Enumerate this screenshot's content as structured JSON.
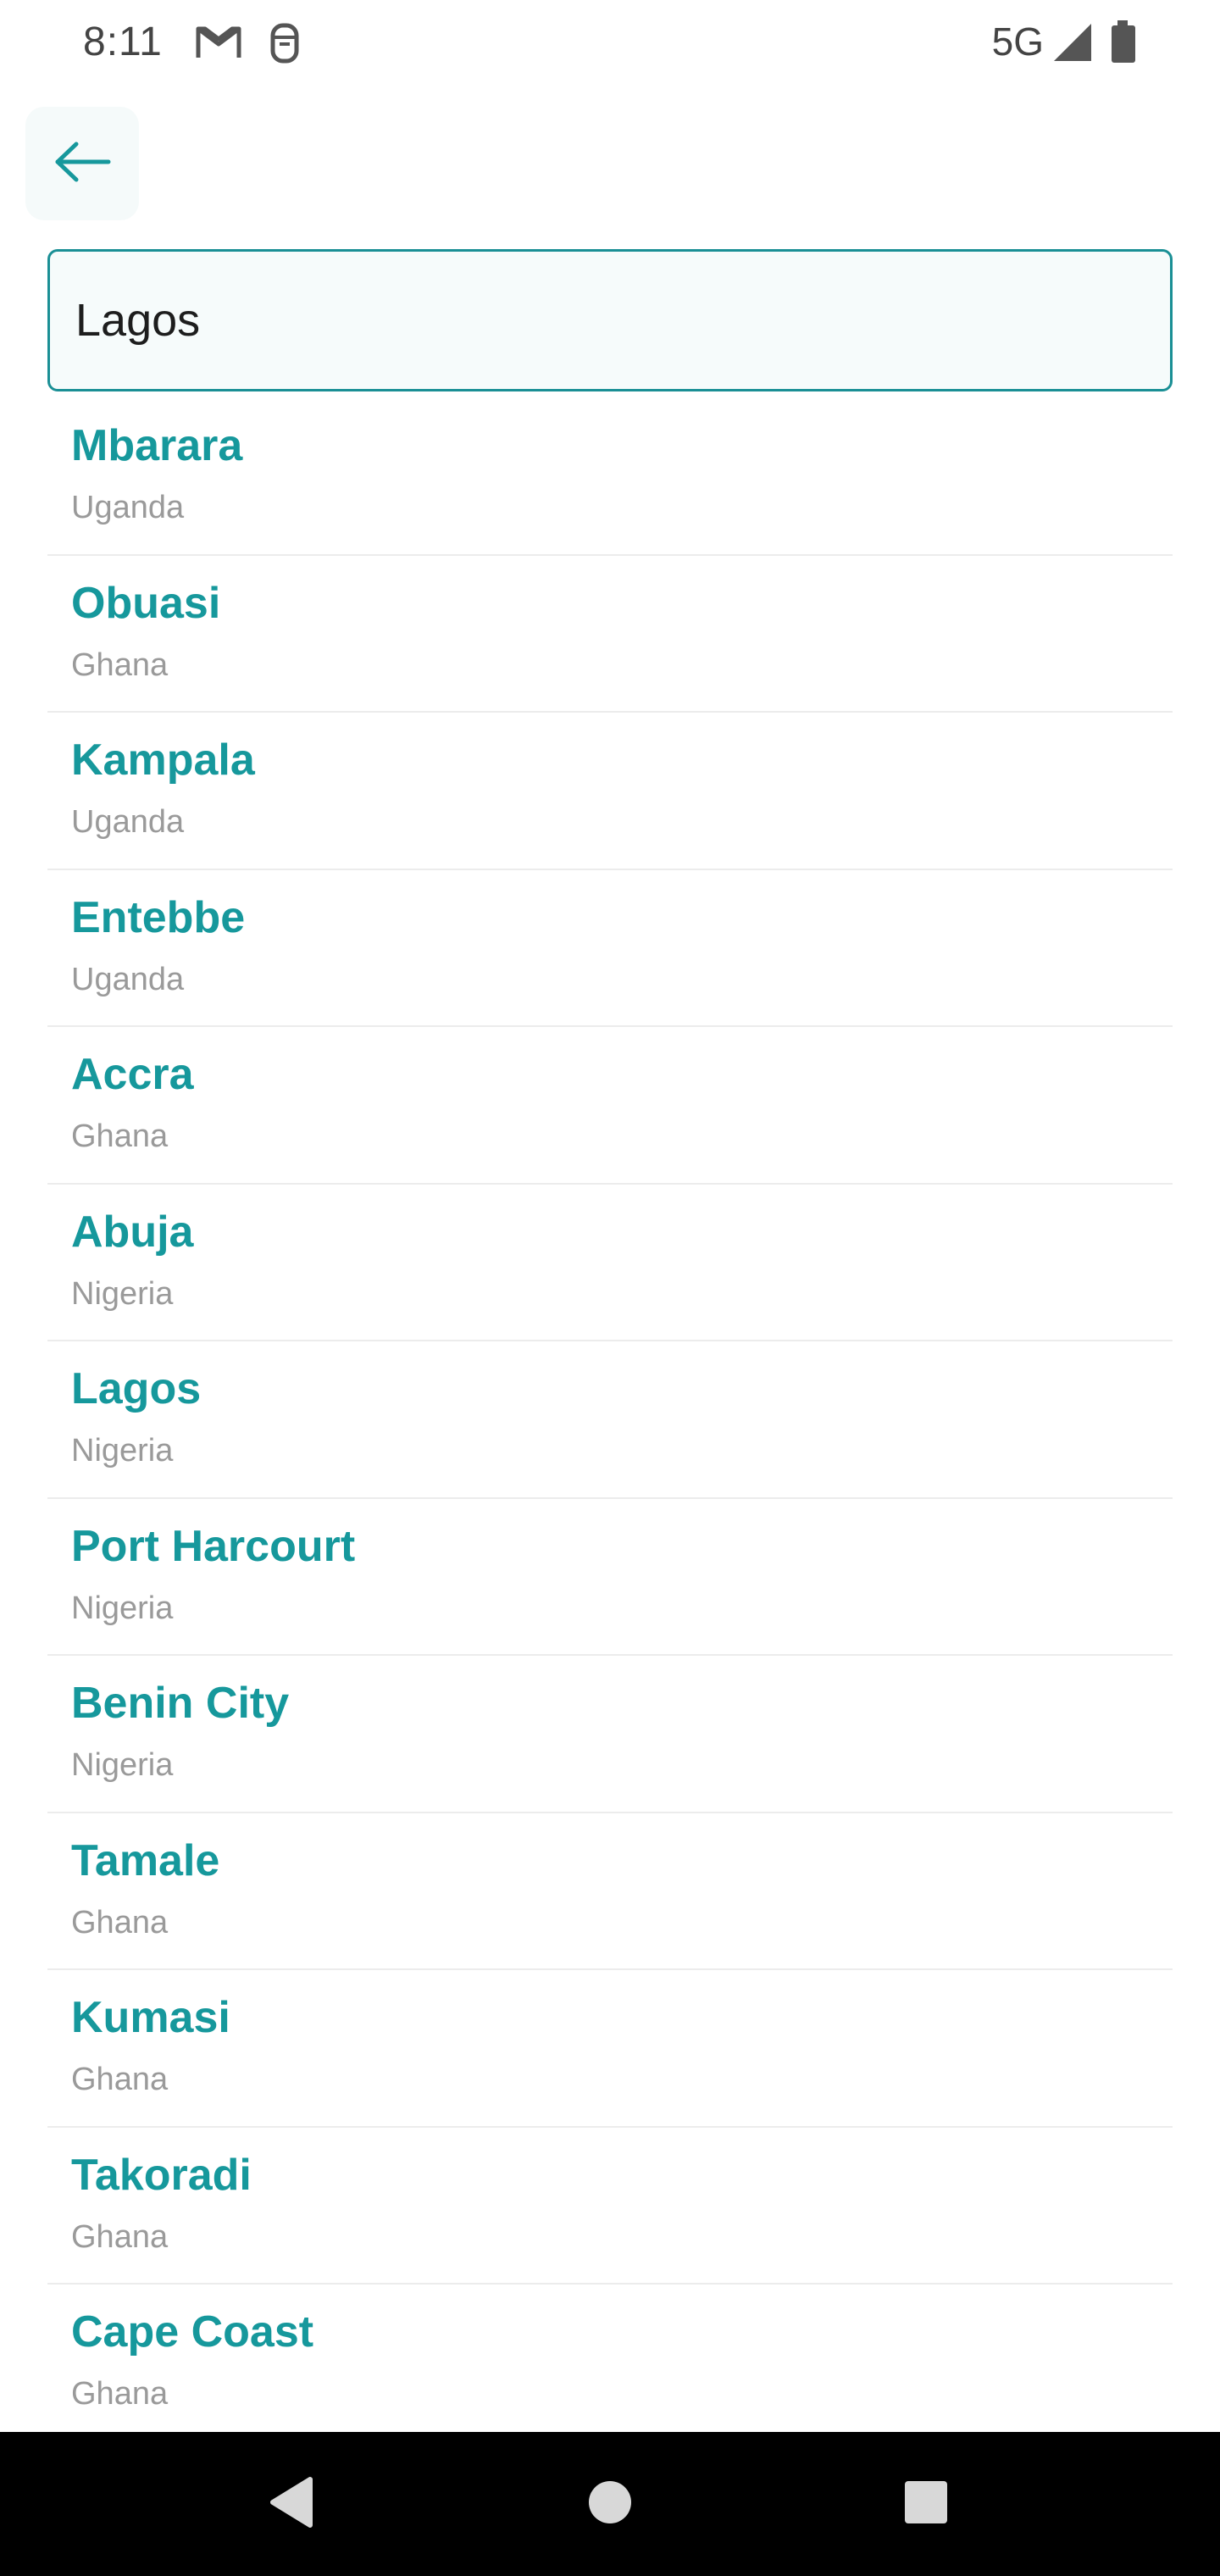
{
  "status_bar": {
    "time": "8:11",
    "network": "5G",
    "icons": [
      "gmail-icon",
      "notification-icon",
      "signal-icon",
      "battery-icon"
    ]
  },
  "back_button": {
    "icon": "arrow-left-icon"
  },
  "search": {
    "value": "Lagos",
    "placeholder": ""
  },
  "cities": [
    {
      "name": "Mbarara",
      "country": "Uganda"
    },
    {
      "name": "Obuasi",
      "country": "Ghana"
    },
    {
      "name": "Kampala",
      "country": "Uganda"
    },
    {
      "name": "Entebbe",
      "country": "Uganda"
    },
    {
      "name": "Accra",
      "country": "Ghana"
    },
    {
      "name": "Abuja",
      "country": "Nigeria"
    },
    {
      "name": "Lagos",
      "country": "Nigeria"
    },
    {
      "name": "Port Harcourt",
      "country": "Nigeria"
    },
    {
      "name": "Benin City",
      "country": "Nigeria"
    },
    {
      "name": "Tamale",
      "country": "Ghana"
    },
    {
      "name": "Kumasi",
      "country": "Ghana"
    },
    {
      "name": "Takoradi",
      "country": "Ghana"
    },
    {
      "name": "Cape Coast",
      "country": "Ghana"
    }
  ],
  "colors": {
    "accent": "#16989c",
    "country_text": "#9a9a9a",
    "divider": "#ececec"
  }
}
